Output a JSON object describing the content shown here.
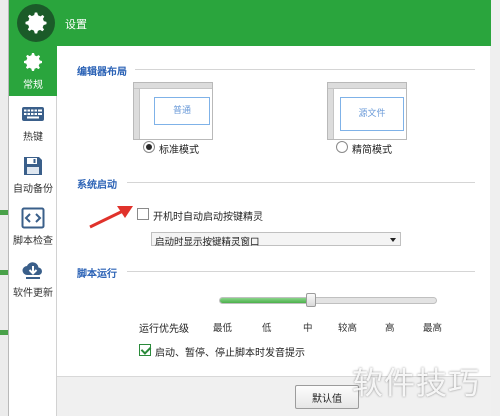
{
  "window": {
    "title": "设置"
  },
  "sidebar": {
    "items": [
      {
        "label": "常规",
        "icon": "gear-icon"
      },
      {
        "label": "热键",
        "icon": "keyboard-icon"
      },
      {
        "label": "自动备份",
        "icon": "floppy-disk-icon"
      },
      {
        "label": "脚本检查",
        "icon": "code-brackets-icon"
      },
      {
        "label": "软件更新",
        "icon": "cloud-download-icon"
      }
    ],
    "active_index": 0
  },
  "layout_section": {
    "title": "编辑器布局",
    "options": [
      {
        "preview_text": "普通",
        "label": "标准模式",
        "selected": true
      },
      {
        "preview_text": "源文件",
        "label": "精简模式",
        "selected": false
      }
    ]
  },
  "startup_section": {
    "title": "系统启动",
    "auto_start_label": "开机时自动启动按键精灵",
    "auto_start_checked": false,
    "startup_display": "启动时显示按键精灵窗口"
  },
  "run_section": {
    "title": "脚本运行",
    "priority_label": "运行优先级",
    "priority_levels": [
      "最低",
      "低",
      "中",
      "较高",
      "高",
      "最高"
    ],
    "priority_value": "中",
    "priority_fraction": 0.42,
    "sound_label": "启动、暂停、停止脚本时发音提示",
    "sound_checked": true
  },
  "footer": {
    "default_button": "默认值"
  },
  "watermark": "软件技巧",
  "colors": {
    "accent": "#2aa53d",
    "section_title": "#2c63b6",
    "arrow": "#e0322b"
  }
}
